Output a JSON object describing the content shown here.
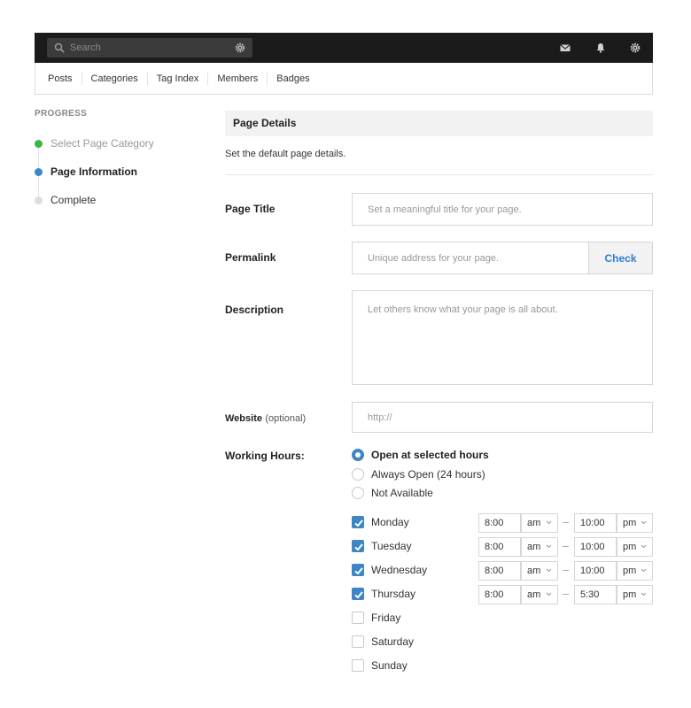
{
  "topbar": {
    "search_placeholder": "Search",
    "icons": [
      "search-icon",
      "gear-icon",
      "mail-icon",
      "bell-icon",
      "gear-icon"
    ]
  },
  "nav": {
    "items": [
      "Posts",
      "Categories",
      "Tag Index",
      "Members",
      "Badges"
    ]
  },
  "progress": {
    "title": "PROGRESS",
    "steps": [
      {
        "label": "Select Page Category",
        "status": "done",
        "color": "#3bb44a"
      },
      {
        "label": "Page Information",
        "status": "current",
        "color": "#3d86c6"
      },
      {
        "label": "Complete",
        "status": "pending",
        "color": "#dddddd"
      }
    ]
  },
  "form": {
    "header": "Page Details",
    "description": "Set the default page details.",
    "page_title": {
      "label": "Page Title",
      "placeholder": "Set a meaningful title for your page."
    },
    "permalink": {
      "label": "Permalink",
      "placeholder": "Unique address for your page.",
      "button": "Check"
    },
    "desc_field": {
      "label": "Description",
      "placeholder": "Let others know what your page is all about."
    },
    "website": {
      "label": "Website",
      "label_suffix": "(optional)",
      "placeholder": "http://"
    },
    "working_hours": {
      "label": "Working Hours:",
      "options": [
        {
          "label": "Open at selected hours",
          "selected": true
        },
        {
          "label": "Always Open (24 hours)",
          "selected": false
        },
        {
          "label": "Not Available",
          "selected": false
        }
      ],
      "days": [
        {
          "name": "Monday",
          "checked": true,
          "from": "8:00",
          "from_ampm": "am",
          "to": "10:00",
          "to_ampm": "pm"
        },
        {
          "name": "Tuesday",
          "checked": true,
          "from": "8:00",
          "from_ampm": "am",
          "to": "10:00",
          "to_ampm": "pm"
        },
        {
          "name": "Wednesday",
          "checked": true,
          "from": "8:00",
          "from_ampm": "am",
          "to": "10:00",
          "to_ampm": "pm"
        },
        {
          "name": "Thursday",
          "checked": true,
          "from": "8:00",
          "from_ampm": "am",
          "to": "5:30",
          "to_ampm": "pm"
        },
        {
          "name": "Friday",
          "checked": false
        },
        {
          "name": "Saturday",
          "checked": false
        },
        {
          "name": "Sunday",
          "checked": false
        }
      ]
    }
  },
  "colors": {
    "accent": "#3d86c6",
    "link": "#2e7dd1",
    "topbar": "#1b1b1b",
    "done": "#3bb44a"
  }
}
